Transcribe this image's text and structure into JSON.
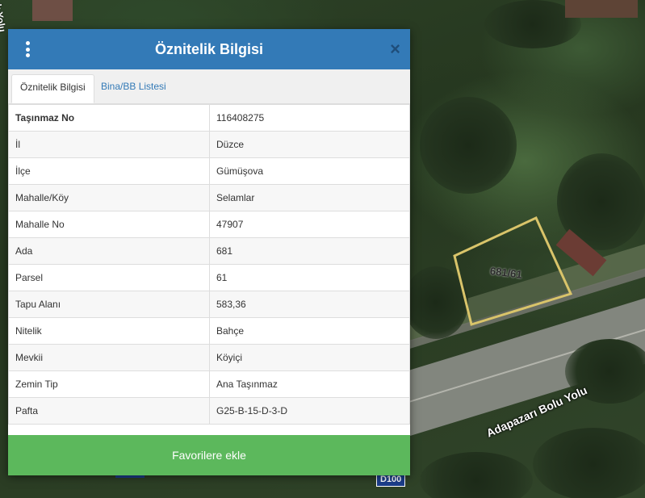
{
  "map": {
    "corner_label": "k Yolu",
    "road_label": "Adapazarı Bolu Yolu",
    "road_badge": "D100",
    "parcel_label": "681/61",
    "parcel_outline_color": "#d9c46a"
  },
  "dialog": {
    "title": "Öznitelik Bilgisi",
    "menu_icon": "kebab-menu-icon",
    "close_symbol": "×",
    "header_color": "#337ab7",
    "tabs": [
      {
        "label": "Öznitelik Bilgisi",
        "active": true
      },
      {
        "label": "Bina/BB Listesi",
        "active": false
      }
    ],
    "rows": [
      {
        "key": "Taşınmaz No",
        "value": "116408275"
      },
      {
        "key": "İl",
        "value": "Düzce"
      },
      {
        "key": "İlçe",
        "value": "Gümüşova"
      },
      {
        "key": "Mahalle/Köy",
        "value": "Selamlar"
      },
      {
        "key": "Mahalle No",
        "value": "47907"
      },
      {
        "key": "Ada",
        "value": "681"
      },
      {
        "key": "Parsel",
        "value": "61"
      },
      {
        "key": "Tapu Alanı",
        "value": "583,36"
      },
      {
        "key": "Nitelik",
        "value": "Bahçe"
      },
      {
        "key": "Mevkii",
        "value": "Köyiçi"
      },
      {
        "key": "Zemin Tip",
        "value": "Ana Taşınmaz"
      },
      {
        "key": "Pafta",
        "value": "G25-B-15-D-3-D"
      }
    ],
    "favorite_button": "Favorilere ekle",
    "favorite_color": "#5cb85c"
  }
}
